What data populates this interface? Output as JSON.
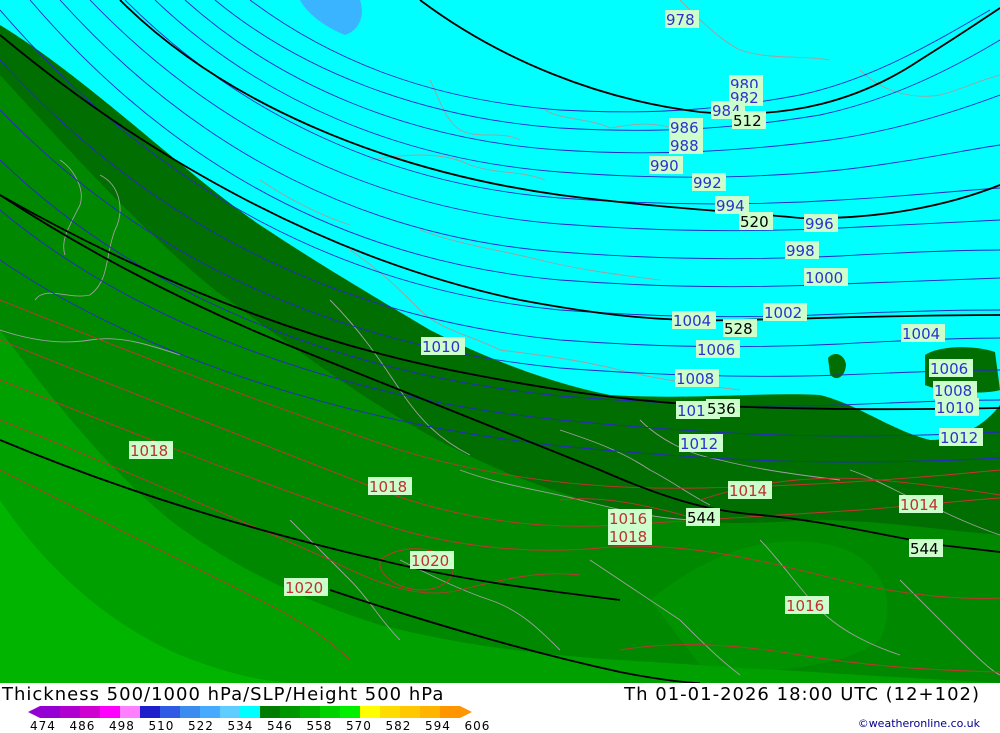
{
  "map": {
    "contour_labels": [
      {
        "text": "978",
        "kind": "slp"
      },
      {
        "text": "980",
        "kind": "slp"
      },
      {
        "text": "982",
        "kind": "slp"
      },
      {
        "text": "984",
        "kind": "slp"
      },
      {
        "text": "986",
        "kind": "slp"
      },
      {
        "text": "988",
        "kind": "slp"
      },
      {
        "text": "990",
        "kind": "slp"
      },
      {
        "text": "992",
        "kind": "slp"
      },
      {
        "text": "994",
        "kind": "slp"
      },
      {
        "text": "996",
        "kind": "slp"
      },
      {
        "text": "998",
        "kind": "slp"
      },
      {
        "text": "1000",
        "kind": "slp"
      },
      {
        "text": "1002",
        "kind": "slp"
      },
      {
        "text": "1004",
        "kind": "slp"
      },
      {
        "text": "1004",
        "kind": "slp"
      },
      {
        "text": "1006",
        "kind": "slp"
      },
      {
        "text": "1006",
        "kind": "slp"
      },
      {
        "text": "1008",
        "kind": "slp"
      },
      {
        "text": "1008",
        "kind": "slp"
      },
      {
        "text": "1010",
        "kind": "slp"
      },
      {
        "text": "1010",
        "kind": "slp"
      },
      {
        "text": "1010",
        "kind": "slp"
      },
      {
        "text": "1012",
        "kind": "slp"
      },
      {
        "text": "1012",
        "kind": "slp"
      },
      {
        "text": "1014",
        "kind": "slp"
      },
      {
        "text": "1014",
        "kind": "slp"
      },
      {
        "text": "1016",
        "kind": "slp"
      },
      {
        "text": "1016",
        "kind": "slp"
      },
      {
        "text": "1018",
        "kind": "slp"
      },
      {
        "text": "1018",
        "kind": "slp"
      },
      {
        "text": "1018",
        "kind": "slp"
      },
      {
        "text": "1020",
        "kind": "slp"
      },
      {
        "text": "1020",
        "kind": "slp"
      },
      {
        "text": "512",
        "kind": "height"
      },
      {
        "text": "520",
        "kind": "height"
      },
      {
        "text": "528",
        "kind": "height"
      },
      {
        "text": "536",
        "kind": "height"
      },
      {
        "text": "544",
        "kind": "height"
      },
      {
        "text": "544",
        "kind": "height"
      }
    ]
  },
  "footer": {
    "title": "Thickness 500/1000 hPa/SLP/Height 500 hPa",
    "datetime": "Th 01-01-2026 18:00 UTC (12+102)",
    "credit": "©weatheronline.co.uk",
    "scale_ticks": [
      "474",
      "486",
      "498",
      "510",
      "522",
      "534",
      "546",
      "558",
      "570",
      "582",
      "594",
      "606"
    ],
    "scale_colors": [
      "#9400d3",
      "#b000d0",
      "#d000d0",
      "#ff00ff",
      "#ff80ff",
      "#1e1ecd",
      "#2e5ae6",
      "#3c8cf0",
      "#46aaff",
      "#5fcdff",
      "#00ffff",
      "#007d00",
      "#009600",
      "#00b400",
      "#00d200",
      "#00f000",
      "#ffff00",
      "#ffdc00",
      "#ffc800",
      "#ffb400",
      "#ff9600"
    ]
  }
}
